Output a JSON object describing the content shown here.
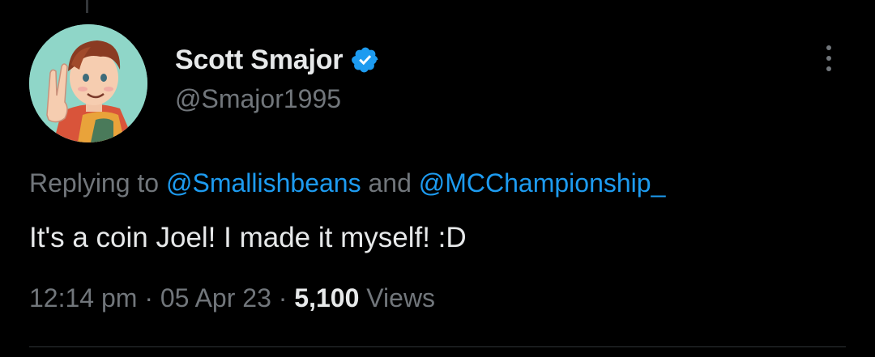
{
  "author": {
    "display_name": "Scott Smajor",
    "handle": "@Smajor1995",
    "verified_icon": "verified-badge-icon",
    "verified_color": "#1d9bf0"
  },
  "reply": {
    "prefix": "Replying to ",
    "mention_1": "@Smallishbeans",
    "conjunction": " and ",
    "mention_2": "@MCChampionship_"
  },
  "tweet": {
    "text": "It's a coin Joel! I made it myself! :D"
  },
  "meta": {
    "time": "12:14 pm",
    "separator_1": " · ",
    "date": "05 Apr 23",
    "separator_2": " · ",
    "views_count": "5,100",
    "views_label": " Views"
  },
  "icons": {
    "more": "more-options-icon"
  },
  "colors": {
    "background": "#000000",
    "primary_text": "#e7e9ea",
    "secondary_text": "#71767b",
    "accent": "#1d9bf0"
  }
}
